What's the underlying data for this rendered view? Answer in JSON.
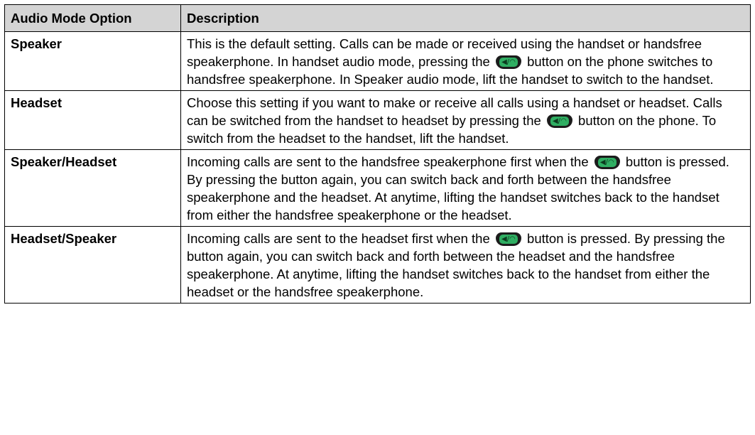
{
  "table": {
    "headers": [
      "Audio Mode Option",
      "Description"
    ],
    "rows": [
      {
        "option": "Speaker",
        "parts": [
          "This is the default setting. Calls can be made or received using the handset or handsfree speakerphone. In handset audio mode, pressing the ",
          " button on the phone switches to handsfree speakerphone. In Speaker audio mode, lift the handset to switch to the handset."
        ]
      },
      {
        "option": "Headset",
        "parts": [
          "Choose this setting if you want to make or receive all calls using a handset or headset. Calls can be switched from the handset to headset by pressing the ",
          " button on the phone. To switch from the headset to the handset, lift the handset."
        ]
      },
      {
        "option": "Speaker/Headset",
        "parts": [
          " Incoming calls are sent to the handsfree speakerphone first when the ",
          " button is pressed. By pressing the button again, you can switch back and forth between the handsfree speakerphone and the headset. At anytime, lifting the handset switches back to the handset from either the handsfree speakerphone or the headset."
        ]
      },
      {
        "option": "Headset/Speaker",
        "parts": [
          "Incoming calls are sent to the headset first when the ",
          " button is pressed. By pressing the button again, you can switch back and forth between the headset and the handsfree speakerphone. At anytime, lifting the handset switches back to the handset from either the headset or the handsfree speakerphone."
        ]
      }
    ]
  },
  "icons": {
    "speaker_headset_button": "speaker-headset-button-icon",
    "button_glyph": "◀/◠",
    "button_body_color": "#1c1c1c",
    "button_face_color": "#2fae62"
  },
  "colors": {
    "header_bg": "#d4d4d4",
    "border": "#000000"
  }
}
